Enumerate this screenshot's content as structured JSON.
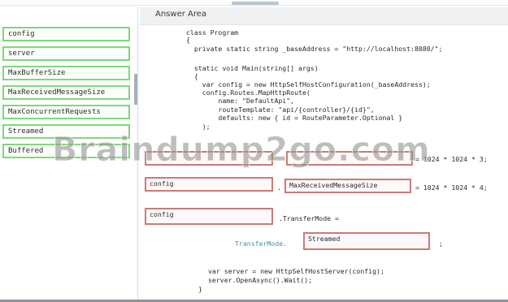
{
  "left_panel": {
    "choices": [
      "config",
      "server",
      "MaxBufferSize",
      "MaxReceivedMessageSize",
      "MaxConcurrentRequests",
      "Streamed",
      "Buffered"
    ]
  },
  "answer_area": {
    "title": "Answer Area",
    "code_top": [
      "class Program",
      "{",
      "  private static string _baseAddress = \"http://localhost:8080/\";",
      "",
      "  static void Main(string[] args)",
      "  {",
      "    var config = new HttpSelfHostConfiguration(_baseAddress);",
      "    config.Routes.MapHttpRoute(",
      "        name: \"DefaultApi\",",
      "        routeTemplate: \"api/{controller}/{id}\",",
      "        defaults: new { id = RouteParameter.Optional }",
      "    );"
    ],
    "row1": {
      "suffix": "= 1024 * 1024 * 3;"
    },
    "row2": {
      "target1": "config",
      "dot": ".",
      "target2": "MaxReceivedMessageSize",
      "suffix": "= 1024 * 1024 * 4;"
    },
    "row3": {
      "target": "config",
      "suffix": ".TransferMode ="
    },
    "row4": {
      "prefix": "TransferMode.",
      "target": "Streamed",
      "suffix": ";"
    },
    "code_bottom": [
      "var server = new HttpSelfHostServer(config);",
      "server.OpenAsync().Wait();",
      "}"
    ]
  },
  "watermark": "Braindump2go.com",
  "colors": {
    "choice_border": "#7fd87b",
    "target_border": "#c97b76",
    "type_color": "#3b94b3",
    "string_color": "#a83c3c"
  }
}
